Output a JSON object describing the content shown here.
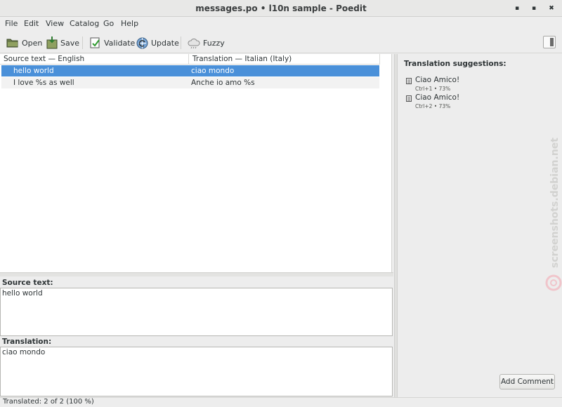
{
  "window": {
    "title": "messages.po • l10n sample - Poedit",
    "controls": {
      "minimize": "▪",
      "maximize": "▪",
      "close": "✖"
    }
  },
  "menu": [
    "File",
    "Edit",
    "View",
    "Catalog",
    "Go",
    "Help"
  ],
  "toolbar": {
    "open": "Open",
    "save": "Save",
    "validate": "Validate",
    "update": "Update",
    "fuzzy": "Fuzzy"
  },
  "list": {
    "columns": [
      "Source text — English",
      "Translation — Italian (Italy)"
    ],
    "rows": [
      {
        "source": "hello world",
        "translation": "ciao mondo"
      },
      {
        "source": "I love %s as well",
        "translation": "Anche io amo %s"
      }
    ]
  },
  "editor": {
    "source_label": "Source text:",
    "source_value": "hello world",
    "translation_label": "Translation:",
    "translation_value": "ciao mondo"
  },
  "sidebar": {
    "heading": "Translation suggestions:",
    "suggestions": [
      {
        "text": "Ciao Amico!",
        "meta": "Ctrl+1 • 73%"
      },
      {
        "text": "Ciao Amico!",
        "meta": "Ctrl+2 • 73%"
      }
    ],
    "add_comment": "Add Comment",
    "watermark": "screenshots.debian.net"
  },
  "status": {
    "text": "Translated: 2 of 2 (100 %)"
  },
  "colors": {
    "selection": "#4a90d9",
    "background": "#ededed"
  }
}
